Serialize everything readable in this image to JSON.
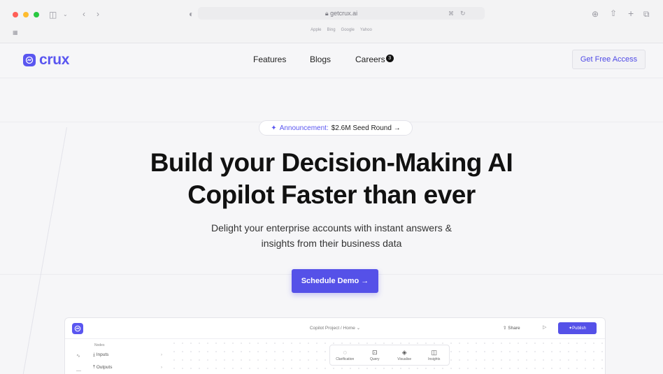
{
  "browser": {
    "address": "getcrux.ai",
    "favorites": [
      "Apple",
      "Bing",
      "Google",
      "Yahoo"
    ]
  },
  "brand": {
    "name": "crux",
    "accent": "#5a56f0"
  },
  "nav": {
    "links": [
      "Features",
      "Blogs",
      "Careers"
    ],
    "careers_badge": "3",
    "cta": "Get Free Access"
  },
  "announcement": {
    "sparkle": "✦",
    "label": "Announcement:",
    "text": "$2.6M Seed Round →"
  },
  "hero": {
    "line1": "Build your Decision-Making AI",
    "line2": "Copilot Faster than ever",
    "sub1": "Delight your enterprise accounts with instant answers &",
    "sub2": "insights from their business data",
    "button": "Schedule Demo →"
  },
  "app_preview": {
    "breadcrumb": "Copilot Project / Home ⌄",
    "share": "Share",
    "publish": "Publish",
    "sidebar_heading": "Nodes",
    "sidebar_items": [
      "Inputs",
      "Outputs"
    ],
    "tools": [
      {
        "label": "Clarification",
        "icon": "chat-bubble-icon"
      },
      {
        "label": "Query",
        "icon": "database-icon"
      },
      {
        "label": "Visualise",
        "icon": "eye-icon"
      },
      {
        "label": "Insights",
        "icon": "book-icon"
      }
    ]
  }
}
